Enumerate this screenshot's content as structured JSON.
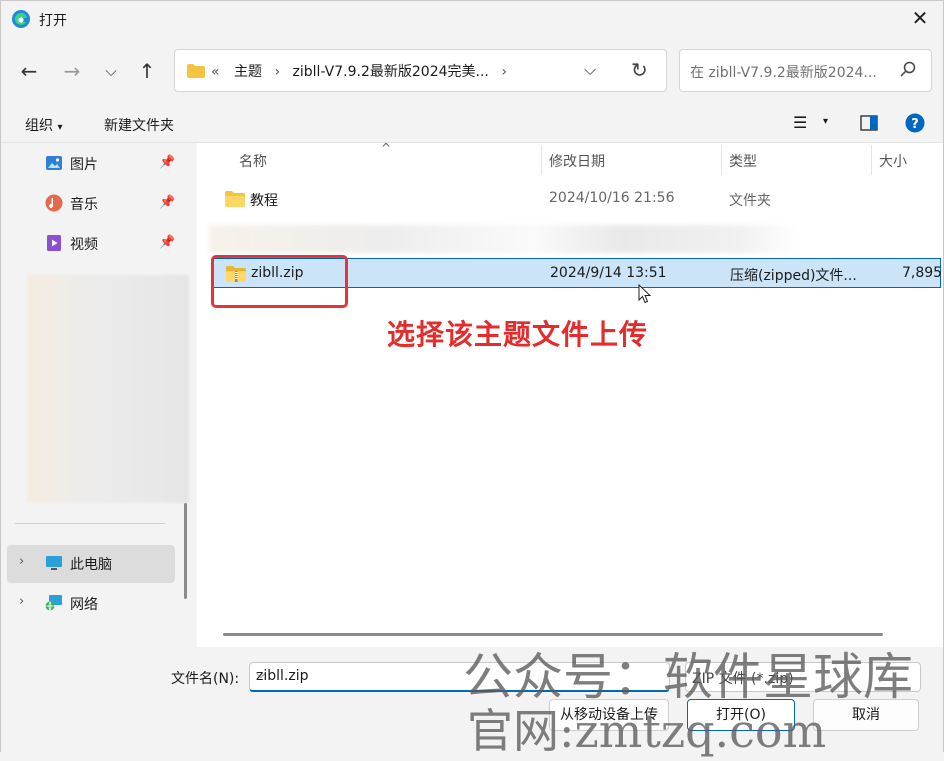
{
  "window": {
    "title": "打开"
  },
  "nav": {
    "breadcrumbs": [
      "«",
      "主题",
      "zibll-V7.9.2最新版2024完美..."
    ],
    "search_placeholder": "在 zibll-V7.9.2最新版2024..."
  },
  "toolbar": {
    "organize": "组织",
    "new_folder": "新建文件夹"
  },
  "sidebar": {
    "quick": [
      {
        "label": "图片",
        "icon": "pictures-icon"
      },
      {
        "label": "音乐",
        "icon": "music-icon"
      },
      {
        "label": "视频",
        "icon": "videos-icon"
      }
    ],
    "tree": [
      {
        "label": "此电脑",
        "icon": "computer-icon"
      },
      {
        "label": "网络",
        "icon": "network-icon"
      }
    ]
  },
  "files": {
    "columns": {
      "name": "名称",
      "modified": "修改日期",
      "type": "类型",
      "size": "大小"
    },
    "rows": [
      {
        "name": "教程",
        "modified": "2024/10/16 21:56",
        "type": "文件夹",
        "size": ""
      },
      {
        "name": "zibll.zip",
        "modified": "2024/9/14 13:51",
        "type": "压缩(zipped)文件...",
        "size": "7,895"
      }
    ]
  },
  "annotation": "选择该主题文件上传",
  "footer": {
    "filename_label": "文件名(N):",
    "filename_value": "zibll.zip",
    "filetype_value": "ZIP 文件 (*.zip)",
    "upload_from_mobile": "从移动设备上传",
    "open": "打开(O)",
    "cancel": "取消"
  },
  "watermark": {
    "line1": "公众号：软件星球库",
    "line2": "官网:zmtzq.com"
  },
  "colors": {
    "accent": "#0067c0",
    "selection": "#cce4f7",
    "annotation_red": "#e52c2c",
    "folder_yellow": "#f5c242"
  }
}
